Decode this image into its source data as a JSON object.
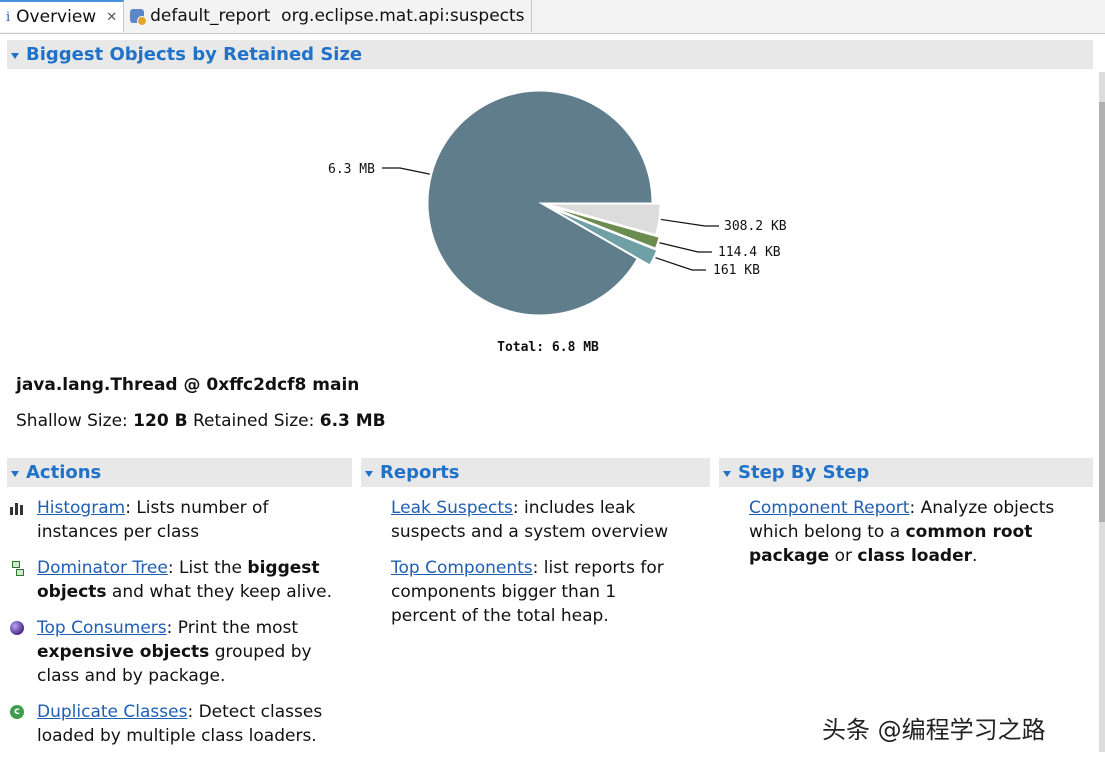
{
  "tabs": [
    {
      "label": "Overview",
      "icon": "info-icon",
      "active": true
    },
    {
      "label": "default_report  org.eclipse.mat.api:suspects",
      "icon": "database-icon",
      "active": false
    }
  ],
  "biggest_objects": {
    "title": "Biggest Objects by Retained Size"
  },
  "chart_data": {
    "type": "pie",
    "slices": [
      {
        "label": "6.3 MB",
        "value": 6.3,
        "unit": "MB",
        "color": "#607d8b"
      },
      {
        "label": "308.2 KB",
        "value": 308.2,
        "unit": "KB",
        "color": "#dcdcdc"
      },
      {
        "label": "114.4 KB",
        "value": 114.4,
        "unit": "KB",
        "color": "#6b8c4e"
      },
      {
        "label": "161 KB",
        "value": 161,
        "unit": "KB",
        "color": "#6fa0a6"
      }
    ],
    "total_label": "Total: 6.8 MB"
  },
  "object": {
    "title": "java.lang.Thread @ 0xffc2dcf8 main",
    "shallow_label": "Shallow Size:",
    "shallow_value": "120 B",
    "retained_label": "Retained Size:",
    "retained_value": "6.3 MB"
  },
  "actions": {
    "title": "Actions",
    "histogram_link": "Histogram",
    "histogram_text": ": Lists number of instances per class",
    "dominator_link": "Dominator Tree",
    "dominator_text_1": ": List the ",
    "dominator_bold_1": "biggest objects",
    "dominator_text_2": " and what they keep alive.",
    "consumers_link": "Top Consumers",
    "consumers_text_1": ": Print the most ",
    "consumers_bold_1": "expensive objects",
    "consumers_text_2": " grouped by class and by package.",
    "duplicate_link": "Duplicate Classes",
    "duplicate_text": ": Detect classes loaded by multiple class loaders."
  },
  "reports": {
    "title": "Reports",
    "leak_link": "Leak Suspects",
    "leak_text": ": includes leak suspects and a system overview",
    "components_link": "Top Components",
    "components_text": ": list reports for components bigger than 1 percent of the total heap."
  },
  "step_by_step": {
    "title": "Step By Step",
    "component_link": "Component Report",
    "component_text_1": ": Analyze objects which belong to a ",
    "component_bold_1": "common root package",
    "component_text_2": " or ",
    "component_bold_2": "class loader",
    "component_text_3": "."
  },
  "watermark": "头条 @编程学习之路"
}
